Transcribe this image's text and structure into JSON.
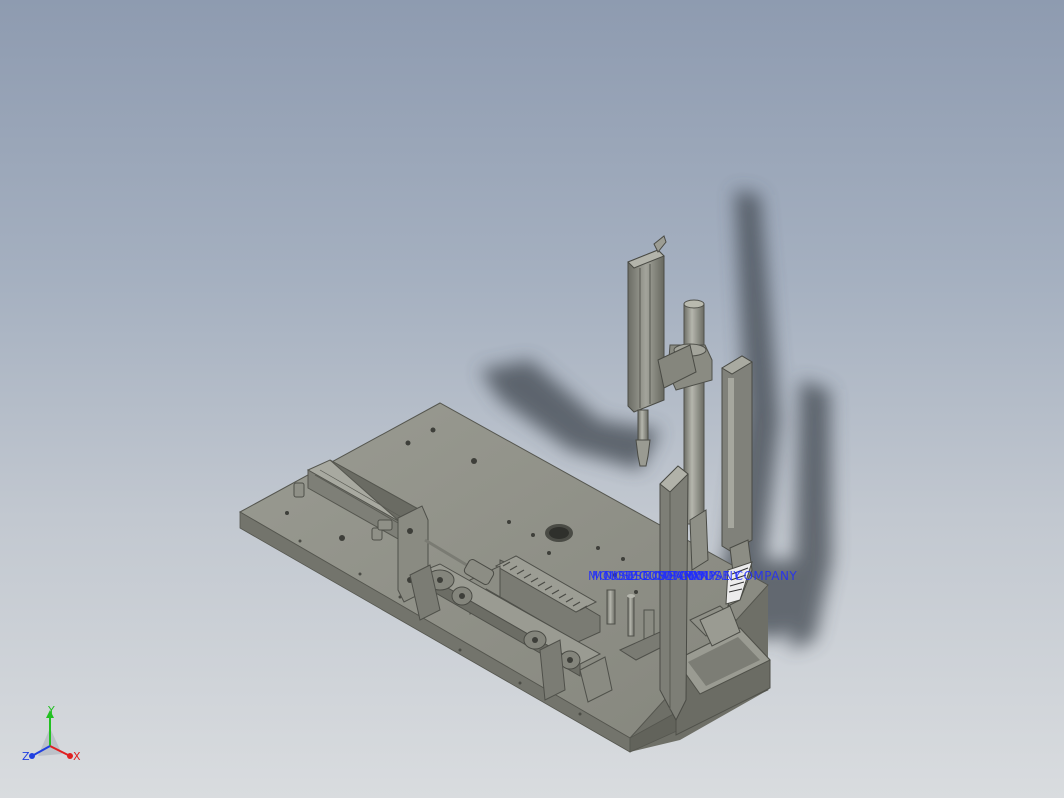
{
  "viewport": {
    "annotation_text": "MOUSE COMPANY",
    "annotation_color": "#1f2cff"
  },
  "triad": {
    "x_label": "X",
    "y_label": "Y",
    "z_label": "Z",
    "x_color": "#e02020",
    "y_color": "#22c022",
    "z_color": "#2040e0"
  },
  "colors": {
    "background_top": "#8e9bb0",
    "background_bottom": "#d9dcdf",
    "part_fill": "#8a8b82",
    "part_shadow": "#5e5f58",
    "part_highlight": "#a9aaa1"
  }
}
